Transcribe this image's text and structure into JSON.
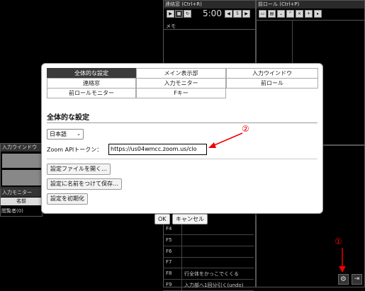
{
  "contact_pane": {
    "title": "連絡窓 (Ctrl+R)",
    "timer": "5:00",
    "spin_value": "5",
    "memo_label": "メモ"
  },
  "preroll_pane": {
    "title": "前ロール (Ctrl+P)"
  },
  "input_window_pane": {
    "title": "入力ウインドウ"
  },
  "input_monitor_pane": {
    "title": "入力モニター",
    "col_name": "名前",
    "viewers": "閲覧者(0)"
  },
  "fkeys": [
    {
      "key": "F4",
      "value": ""
    },
    {
      "key": "F5",
      "value": ""
    },
    {
      "key": "F6",
      "value": ""
    },
    {
      "key": "F7",
      "value": ""
    },
    {
      "key": "F8",
      "value": "行全体をかっこでくくる"
    },
    {
      "key": "F9",
      "value": "入力部へ1回分引く(undo)"
    }
  ],
  "dialog": {
    "tabs": [
      "全体的な設定",
      "メイン表示部",
      "入力ウインドウ",
      "連絡窓",
      "入力モニター",
      "前ロール",
      "前ロールモニター",
      "Fキー"
    ],
    "section_title": "全体的な設定",
    "language": "日本語",
    "zoom_label": "Zoom APIトークン：",
    "zoom_value": "https://us04wmcc.zoom.us/clo",
    "btn_open": "設定ファイルを開く…",
    "btn_save_as": "設定に名前をつけて保存…",
    "btn_reset": "設定を初期化",
    "ok": "OK",
    "cancel": "キャンセル"
  },
  "annotations": {
    "one": "①",
    "two": "②"
  },
  "colors": {
    "annotation": "#e00000",
    "active_tab": "#3b3b3b"
  }
}
